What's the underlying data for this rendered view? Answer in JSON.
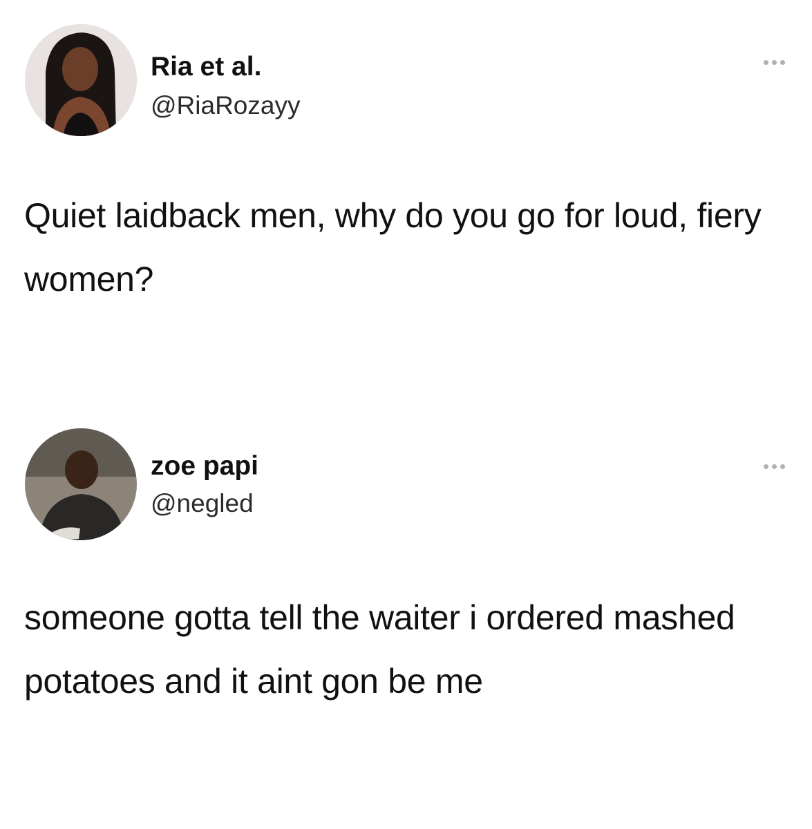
{
  "tweets": [
    {
      "display_name": "Ria et al.",
      "handle": "@RiaRozayy",
      "text": "Quiet laidback men, why do you go for loud, fiery women?",
      "avatar_icon": "profile-photo-icon",
      "more_icon": "more-dots-icon"
    },
    {
      "display_name": "zoe papi",
      "handle": "@negled",
      "text": "someone gotta tell the waiter i ordered mashed potatoes and it aint gon be me",
      "avatar_icon": "profile-photo-icon",
      "more_icon": "more-dots-icon"
    }
  ],
  "colors": {
    "background": "#ffffff",
    "text": "#111111",
    "handle": "#2b2b2b",
    "dots": "#b0b0b0"
  }
}
